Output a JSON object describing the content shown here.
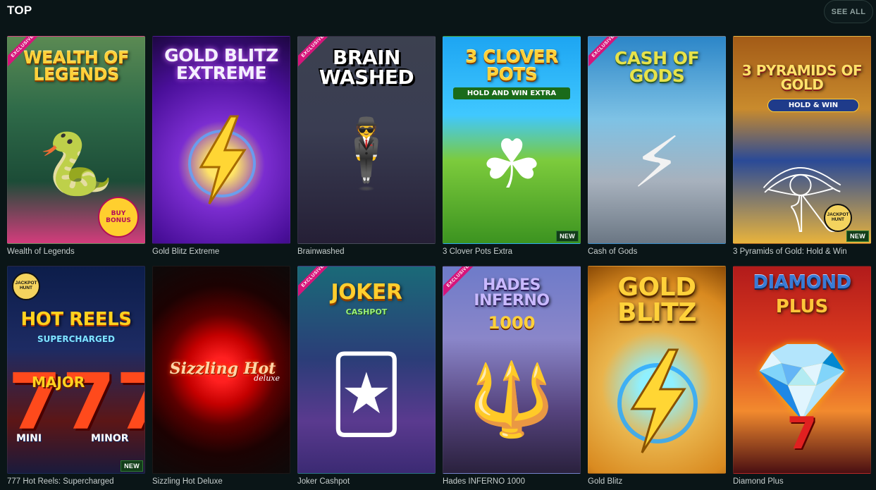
{
  "section": {
    "title": "TOP",
    "see_all_label": "SEE ALL"
  },
  "games": [
    {
      "name": "Wealth of Legends",
      "art_title": "WEALTH OF LEGENDS",
      "exclusive": true,
      "exclusive_label": "EXCLUSIVE",
      "badge": "",
      "extra_badge": "BUY BONUS"
    },
    {
      "name": "Gold Blitz Extreme",
      "art_title": "GOLD BLITZ EXTREME",
      "exclusive": false,
      "badge": ""
    },
    {
      "name": "Brainwashed",
      "art_title": "BRAIN WASHED",
      "exclusive": true,
      "exclusive_label": "EXCLUSIVE",
      "badge": ""
    },
    {
      "name": "3 Clover Pots Extra",
      "art_title": "3 CLOVER POTS",
      "art_sub": "HOLD AND WIN EXTRA",
      "exclusive": false,
      "badge": "NEW"
    },
    {
      "name": "Cash of Gods",
      "art_title": "CASH OF GODS",
      "exclusive": true,
      "exclusive_label": "EXCLUSIVE",
      "badge": ""
    },
    {
      "name": "3 Pyramids of Gold: Hold & Win",
      "art_title": "3 PYRAMIDS OF GOLD",
      "art_sub": "HOLD & WIN",
      "exclusive": false,
      "badge": "NEW",
      "jackpot_badge": "JACKPOT HUNT"
    },
    {
      "name": "777 Hot Reels: Supercharged",
      "art_title": "HOT REELS",
      "art_sub": "SUPERCHARGED",
      "art_major": "MAJOR",
      "art_mini": "MINI",
      "art_minor": "MINOR",
      "exclusive": false,
      "badge": "NEW",
      "jackpot_badge": "JACKPOT HUNT"
    },
    {
      "name": "Sizzling Hot Deluxe",
      "art_title": "Sizzling Hot",
      "art_sub": "deluxe",
      "exclusive": false,
      "badge": ""
    },
    {
      "name": "Joker Cashpot",
      "art_title": "JOKER",
      "art_sub": "CASHPOT",
      "exclusive": true,
      "exclusive_label": "EXCLUSIVE",
      "badge": ""
    },
    {
      "name": "Hades INFERNO 1000",
      "art_title": "HADES INFERNO",
      "art_sub": "1000",
      "exclusive": true,
      "exclusive_label": "EXCLUSIVE",
      "badge": ""
    },
    {
      "name": "Gold Blitz",
      "art_title": "GOLD BLITZ",
      "exclusive": false,
      "badge": ""
    },
    {
      "name": "Diamond Plus",
      "art_title": "DIAMOND",
      "art_sub": "PLUS",
      "exclusive": false,
      "badge": ""
    }
  ]
}
